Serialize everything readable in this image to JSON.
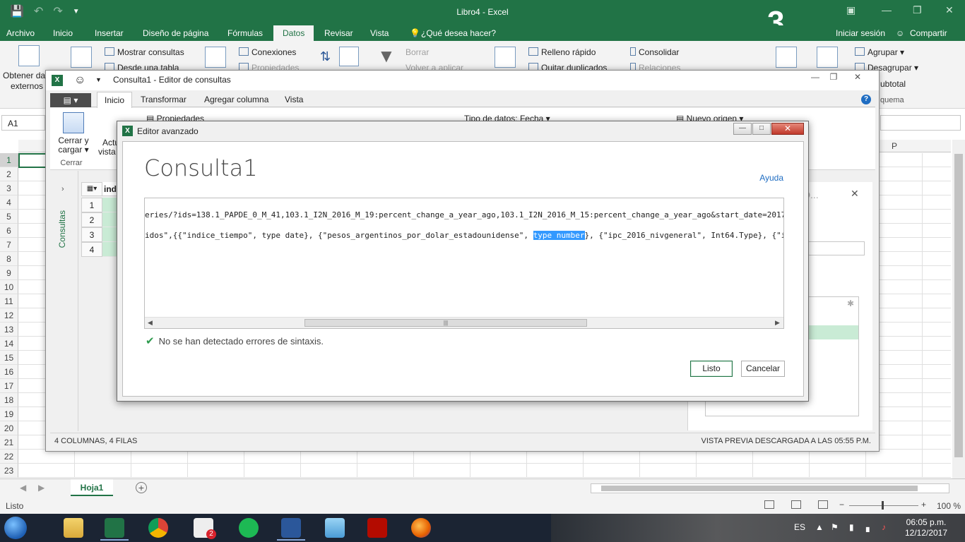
{
  "excel": {
    "doc_title": "Libro4 - Excel",
    "overlay_number": "3",
    "tabs": [
      "Archivo",
      "Inicio",
      "Insertar",
      "Diseño de página",
      "Fórmulas",
      "Datos",
      "Revisar",
      "Vista"
    ],
    "active_tab": "Datos",
    "tell_me": "¿Qué desea hacer?",
    "signin": "Iniciar sesión",
    "share": "Compartir",
    "ribbon": {
      "get_data": "Obtener dat",
      "get_data2": "externos",
      "show_queries": "Mostrar consultas",
      "from_table": "Desde una tabla",
      "connections": "Conexiones",
      "properties": "Propiedades",
      "clear": "Borrar",
      "reapply": "Volver a aplicar",
      "flash_fill": "Relleno rápido",
      "remove_dup": "Quitar duplicados",
      "consolidate": "Consolidar",
      "relations": "Relaciones",
      "group": "Agrupar",
      "ungroup": "Desagrupar",
      "subtotal": "ubtotal",
      "outline": "quema"
    },
    "name_box": "A1",
    "col_p": "P",
    "rows": [
      "1",
      "2",
      "3",
      "4",
      "5",
      "6",
      "7",
      "8",
      "9",
      "10",
      "11",
      "12",
      "13",
      "14",
      "15",
      "16",
      "17",
      "18",
      "19",
      "20",
      "21",
      "22",
      "23"
    ],
    "sheet_tab": "Hoja1",
    "status": "Listo",
    "zoom": "100 %"
  },
  "query_editor": {
    "title": "Consulta1 - Editor de consultas",
    "tabs": [
      "Inicio",
      "Transformar",
      "Agregar columna",
      "Vista"
    ],
    "active_tab": "Inicio",
    "close_load": "Cerrar y",
    "close_load2": "cargar",
    "close_group": "Cerrar",
    "refresh": "Actu",
    "refresh2": "vista p",
    "properties": "Propiedades",
    "data_type": "Tipo de datos: Fecha",
    "new_source": "Nuevo origen",
    "sidebar": "Consultas",
    "preview_rows": [
      "1",
      "2",
      "3",
      "4"
    ],
    "col_header": "ind",
    "status_left": "4 COLUMNAS, 4 FILAS",
    "status_right": "VISTA PREVIA DESCARGADA A LAS 05:55 P.M.",
    "settings_title": "CO..."
  },
  "advanced_editor": {
    "title": "Editor avanzado",
    "query_name": "Consulta1",
    "help": "Ayuda",
    "code_line1": "eries/?ids=138.1_PAPDE_0_M_41,103.1_I2N_2016_M_19:percent_change_a_year_ago,103.1_I2N_2016_M_15:percent_change_a_year_ago&start_date=2017",
    "code_line2_pre": "idos\",{{\"indice_tiempo\", type date}, {\"pesos_argentinos_por_dolar_estadounidense\", ",
    "code_line2_sel": "type number",
    "code_line2_post": "}, {\"ipc_2016_nivgeneral\", Int64.Type}, {\"i",
    "status": "No se han detectado errores de sintaxis.",
    "btn_done": "Listo",
    "btn_cancel": "Cancelar"
  },
  "taskbar": {
    "lang": "ES",
    "time": "06:05 p.m.",
    "date": "12/12/2017",
    "badge": "2"
  }
}
